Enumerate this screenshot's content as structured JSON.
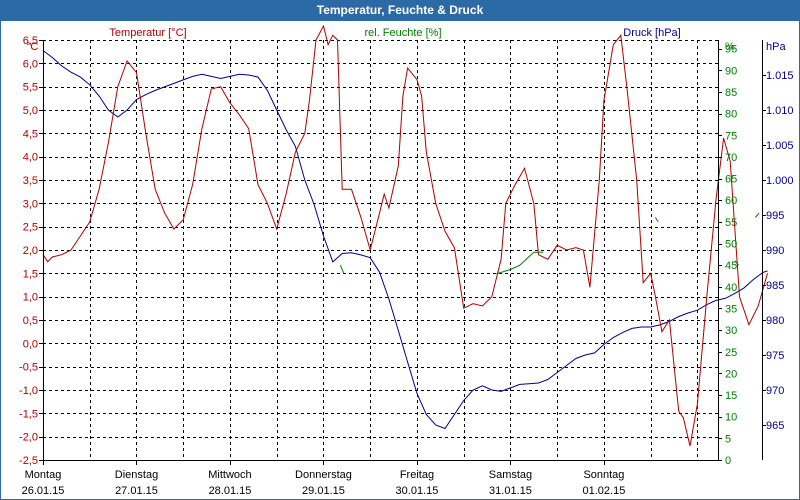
{
  "title": "Temperatur, Feuchte & Druck",
  "colors": {
    "title_bg": "#2c6aa6",
    "temperature": "#b00000",
    "humidity": "#008000",
    "pressure": "#00008c",
    "grid": "#000000"
  },
  "chart_data": {
    "type": "line",
    "title": "Temperatur, Feuchte & Druck",
    "grid": true,
    "x_categories": [
      {
        "day": "Montag",
        "date": "26.01.15"
      },
      {
        "day": "Dienstag",
        "date": "27.01.15"
      },
      {
        "day": "Mittwoch",
        "date": "28.01.15"
      },
      {
        "day": "Donnerstag",
        "date": "29.01.15"
      },
      {
        "day": "Freitag",
        "date": "30.01.15"
      },
      {
        "day": "Samstag",
        "date": "31.01.15"
      },
      {
        "day": "Sonntag",
        "date": "01.02.15"
      }
    ],
    "axes": {
      "temperature": {
        "unit": "°C",
        "range": [
          -2.5,
          6.5
        ],
        "ticks": [
          "6,5",
          "6,0",
          "5,5",
          "5,0",
          "4,5",
          "4,0",
          "3,5",
          "3,0",
          "2,5",
          "2,0",
          "1,5",
          "1,0",
          "0,5",
          "0,0",
          "-0,5",
          "-1,0",
          "-1,5",
          "-2,0",
          "-2,5"
        ]
      },
      "humidity": {
        "unit": "%",
        "range": [
          0,
          97
        ],
        "ticks": [
          "95",
          "90",
          "85",
          "80",
          "75",
          "70",
          "65",
          "60",
          "55",
          "50",
          "45",
          "40",
          "35",
          "30",
          "25",
          "20",
          "15",
          "10",
          "5",
          "0"
        ]
      },
      "pressure": {
        "unit": "hPa",
        "range": [
          960,
          1020
        ],
        "ticks": [
          "1.015",
          "1.010",
          "1.005",
          "1.000",
          "995",
          "990",
          "985",
          "980",
          "975",
          "970",
          "965"
        ]
      }
    },
    "series": [
      {
        "name": "Temperatur [°C]",
        "axis": "temperature",
        "points": [
          [
            0.0,
            1.9
          ],
          [
            0.05,
            1.75
          ],
          [
            0.1,
            1.85
          ],
          [
            0.2,
            1.9
          ],
          [
            0.3,
            2.0
          ],
          [
            0.4,
            2.3
          ],
          [
            0.5,
            2.6
          ],
          [
            0.6,
            3.3
          ],
          [
            0.7,
            4.3
          ],
          [
            0.8,
            5.5
          ],
          [
            0.9,
            6.05
          ],
          [
            1.0,
            5.8
          ],
          [
            1.1,
            4.5
          ],
          [
            1.2,
            3.3
          ],
          [
            1.3,
            2.8
          ],
          [
            1.4,
            2.45
          ],
          [
            1.5,
            2.65
          ],
          [
            1.6,
            3.4
          ],
          [
            1.7,
            4.6
          ],
          [
            1.8,
            5.45
          ],
          [
            1.9,
            5.5
          ],
          [
            2.0,
            5.15
          ],
          [
            2.1,
            4.9
          ],
          [
            2.2,
            4.6
          ],
          [
            2.3,
            3.4
          ],
          [
            2.4,
            3.0
          ],
          [
            2.5,
            2.45
          ],
          [
            2.6,
            3.2
          ],
          [
            2.7,
            4.1
          ],
          [
            2.8,
            4.5
          ],
          [
            2.85,
            5.2
          ],
          [
            2.92,
            6.5
          ],
          [
            3.0,
            6.8
          ],
          [
            3.05,
            6.4
          ],
          [
            3.1,
            6.6
          ],
          [
            3.15,
            6.5
          ],
          [
            3.2,
            3.3
          ],
          [
            3.3,
            3.3
          ],
          [
            3.4,
            2.7
          ],
          [
            3.5,
            2.0
          ],
          [
            3.6,
            2.8
          ],
          [
            3.65,
            3.2
          ],
          [
            3.7,
            2.9
          ],
          [
            3.8,
            3.8
          ],
          [
            3.85,
            5.3
          ],
          [
            3.9,
            5.9
          ],
          [
            4.0,
            5.65
          ],
          [
            4.05,
            5.3
          ],
          [
            4.1,
            4.1
          ],
          [
            4.2,
            3.0
          ],
          [
            4.3,
            2.4
          ],
          [
            4.4,
            2.05
          ],
          [
            4.5,
            0.75
          ],
          [
            4.6,
            0.85
          ],
          [
            4.7,
            0.8
          ],
          [
            4.8,
            1.0
          ],
          [
            4.9,
            1.8
          ],
          [
            4.95,
            3.0
          ],
          [
            5.05,
            3.4
          ],
          [
            5.15,
            3.75
          ],
          [
            5.25,
            3.0
          ],
          [
            5.3,
            1.9
          ],
          [
            5.4,
            1.8
          ],
          [
            5.5,
            2.1
          ],
          [
            5.6,
            2.0
          ],
          [
            5.7,
            2.05
          ],
          [
            5.78,
            2.0
          ],
          [
            5.85,
            1.2
          ],
          [
            5.95,
            3.5
          ],
          [
            6.0,
            5.2
          ],
          [
            6.1,
            6.4
          ],
          [
            6.18,
            6.6
          ],
          [
            6.25,
            5.4
          ],
          [
            6.35,
            3.5
          ],
          [
            6.42,
            1.3
          ],
          [
            6.5,
            1.5
          ],
          [
            6.55,
            1.0
          ],
          [
            6.62,
            0.25
          ],
          [
            6.7,
            0.5
          ],
          [
            6.8,
            -1.45
          ],
          [
            6.85,
            -1.6
          ],
          [
            6.92,
            -2.2
          ],
          [
            7.0,
            -1.3
          ],
          [
            7.1,
            1.0
          ],
          [
            7.2,
            3.1
          ],
          [
            7.28,
            4.4
          ],
          [
            7.35,
            3.9
          ],
          [
            7.45,
            1.0
          ],
          [
            7.55,
            0.4
          ],
          [
            7.65,
            0.8
          ],
          [
            7.75,
            1.5
          ]
        ]
      },
      {
        "name": "rel. Feuchte [%]",
        "axis": "humidity",
        "segments": [
          [
            [
              3.18,
              45
            ],
            [
              3.22,
              43
            ]
          ],
          [
            [
              4.85,
              43
            ],
            [
              5.0,
              44
            ],
            [
              5.1,
              45
            ],
            [
              5.25,
              48
            ],
            [
              5.35,
              48
            ]
          ],
          [
            [
              6.55,
              56
            ],
            [
              6.58,
              55
            ]
          ],
          [
            [
              7.4,
              46
            ],
            [
              7.44,
              45
            ]
          ],
          [
            [
              7.62,
              56
            ],
            [
              7.66,
              57
            ]
          ]
        ]
      },
      {
        "name": "Druck [hPa]",
        "axis": "pressure",
        "points": [
          [
            0.0,
            1018.5
          ],
          [
            0.1,
            1017.5
          ],
          [
            0.2,
            1016.3
          ],
          [
            0.3,
            1015.4
          ],
          [
            0.4,
            1014.7
          ],
          [
            0.5,
            1013.6
          ],
          [
            0.6,
            1012.0
          ],
          [
            0.7,
            1010.0
          ],
          [
            0.8,
            1009.0
          ],
          [
            0.9,
            1010.0
          ],
          [
            1.0,
            1011.5
          ],
          [
            1.1,
            1012.2
          ],
          [
            1.2,
            1012.8
          ],
          [
            1.3,
            1013.3
          ],
          [
            1.4,
            1013.8
          ],
          [
            1.5,
            1014.3
          ],
          [
            1.6,
            1014.8
          ],
          [
            1.7,
            1015.1
          ],
          [
            1.8,
            1014.8
          ],
          [
            1.9,
            1014.5
          ],
          [
            2.0,
            1014.8
          ],
          [
            2.1,
            1015.1
          ],
          [
            2.2,
            1015.0
          ],
          [
            2.3,
            1014.7
          ],
          [
            2.4,
            1012.8
          ],
          [
            2.5,
            1010.0
          ],
          [
            2.6,
            1007.2
          ],
          [
            2.7,
            1004.8
          ],
          [
            2.8,
            1000.0
          ],
          [
            2.9,
            996.5
          ],
          [
            3.0,
            992.0
          ],
          [
            3.1,
            988.3
          ],
          [
            3.2,
            989.5
          ],
          [
            3.3,
            989.6
          ],
          [
            3.4,
            989.3
          ],
          [
            3.5,
            988.9
          ],
          [
            3.6,
            986.8
          ],
          [
            3.7,
            983.0
          ],
          [
            3.8,
            978.5
          ],
          [
            3.9,
            974.0
          ],
          [
            4.0,
            969.5
          ],
          [
            4.1,
            966.5
          ],
          [
            4.2,
            965.0
          ],
          [
            4.3,
            964.5
          ],
          [
            4.4,
            966.5
          ],
          [
            4.5,
            968.5
          ],
          [
            4.6,
            970.0
          ],
          [
            4.7,
            970.6
          ],
          [
            4.8,
            970.0
          ],
          [
            4.9,
            969.8
          ],
          [
            5.0,
            970.3
          ],
          [
            5.1,
            970.8
          ],
          [
            5.2,
            970.9
          ],
          [
            5.3,
            971.0
          ],
          [
            5.4,
            971.5
          ],
          [
            5.5,
            972.5
          ],
          [
            5.6,
            973.5
          ],
          [
            5.7,
            974.5
          ],
          [
            5.8,
            975.0
          ],
          [
            5.9,
            975.3
          ],
          [
            6.0,
            976.5
          ],
          [
            6.1,
            977.5
          ],
          [
            6.2,
            978.2
          ],
          [
            6.3,
            978.8
          ],
          [
            6.4,
            979.0
          ],
          [
            6.5,
            979.0
          ],
          [
            6.6,
            979.3
          ],
          [
            6.7,
            979.8
          ],
          [
            6.8,
            980.5
          ],
          [
            6.9,
            981.0
          ],
          [
            7.0,
            981.4
          ],
          [
            7.1,
            982.2
          ],
          [
            7.2,
            982.8
          ],
          [
            7.3,
            983.1
          ],
          [
            7.4,
            983.8
          ],
          [
            7.5,
            984.6
          ],
          [
            7.6,
            985.8
          ],
          [
            7.7,
            986.8
          ],
          [
            7.75,
            987.0
          ]
        ]
      }
    ]
  }
}
